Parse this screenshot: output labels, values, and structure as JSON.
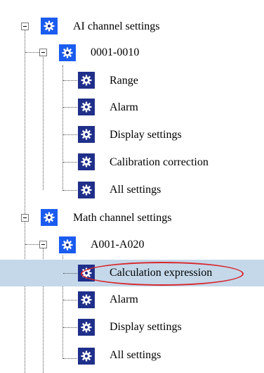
{
  "tree": {
    "nodes": [
      {
        "label": "AI channel settings",
        "icon": "gear-icon",
        "expanded": true
      },
      {
        "label": "0001-0010",
        "icon": "gear-icon",
        "expanded": true
      },
      {
        "label": "Range",
        "icon": "gear-icon"
      },
      {
        "label": "Alarm",
        "icon": "gear-icon"
      },
      {
        "label": "Display settings",
        "icon": "gear-icon"
      },
      {
        "label": "Calibration correction",
        "icon": "gear-icon"
      },
      {
        "label": "All settings",
        "icon": "gear-icon"
      },
      {
        "label": "Math channel settings",
        "icon": "gear-icon",
        "expanded": true
      },
      {
        "label": "A001-A020",
        "icon": "gear-icon",
        "expanded": true
      },
      {
        "label": "Calculation expression",
        "icon": "gear-icon",
        "selected": true,
        "highlighted": true
      },
      {
        "label": "Alarm",
        "icon": "gear-icon"
      },
      {
        "label": "Display settings",
        "icon": "gear-icon"
      },
      {
        "label": "All settings",
        "icon": "gear-icon"
      }
    ]
  },
  "colors": {
    "folder_icon": "#1b5cf0",
    "leaf_icon": "#1f2f8a",
    "selection_bg": "#c4d8ea",
    "annotation": "#d8262c"
  }
}
